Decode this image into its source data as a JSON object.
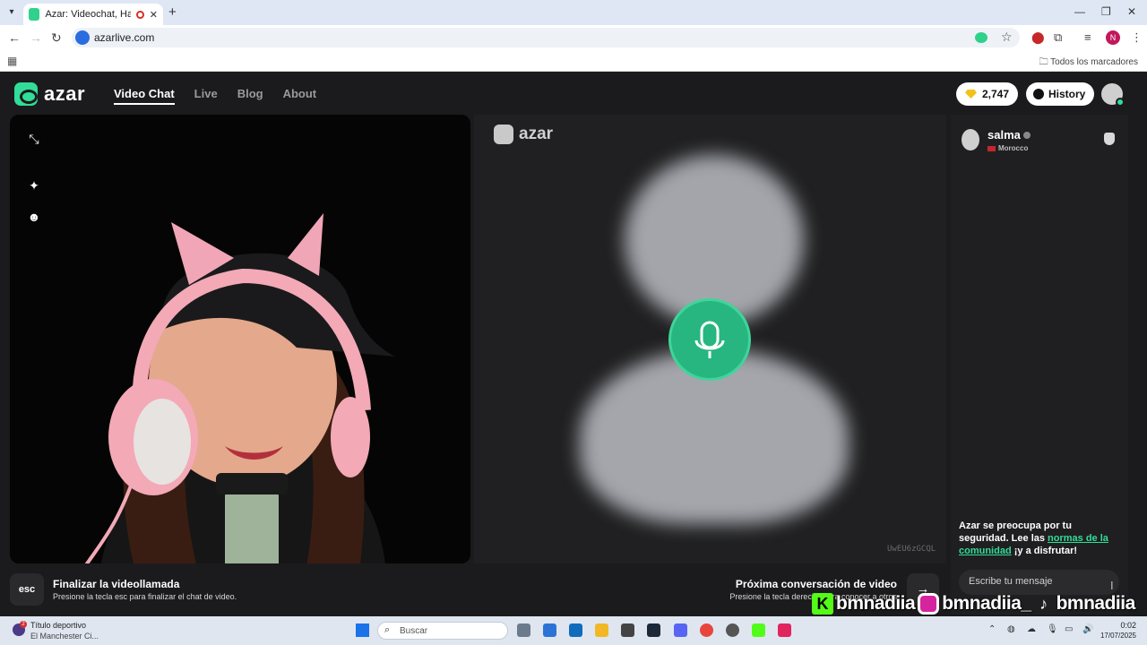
{
  "browser": {
    "tab_title": "Azar: Videochat, Haz nuevos amigos",
    "new_tab": "+",
    "url": "azarlive.com",
    "bookmarks_all": "Todos los marcadores",
    "profile_initial": "N",
    "window_controls": {
      "minimize": "—",
      "restore": "❐",
      "close": "✕"
    }
  },
  "header": {
    "logo_text": "azar",
    "nav": [
      {
        "label": "Video Chat",
        "active": true
      },
      {
        "label": "Live",
        "active": false
      },
      {
        "label": "Blog",
        "active": false
      },
      {
        "label": "About",
        "active": false
      }
    ],
    "gems": "2,747",
    "history": "History"
  },
  "video": {
    "partner_logo": "azar",
    "video_id": "UwEU6zGCQL"
  },
  "chat": {
    "partner_name": "salma",
    "partner_country": "Morocco",
    "safety_part1": "Azar se preocupa por tu seguridad. Lee las ",
    "safety_link": "normas de la comunidad",
    "safety_part2": " ¡y a disfrutar!",
    "input_placeholder": "Escribe tu mensaje"
  },
  "footer": {
    "esc_key": "esc",
    "end_title": "Finalizar la videollamada",
    "end_sub": "Presione la tecla esc para finalizar el chat de video.",
    "next_title": "Próxima conversación de video",
    "next_sub": "Presione la tecla derecha para conocer a otros",
    "next_key": "→"
  },
  "watermark": {
    "kick_letter": "K",
    "handle1": "bmnadiia",
    "handle2": "bmnadiia_",
    "handle3": "bmnadiia"
  },
  "taskbar": {
    "news_badge": "2",
    "news_title": "Título deportivo",
    "news_sub": "El Manchester Ci...",
    "search": "Buscar",
    "time": "0:02",
    "date": "17/07/2025"
  }
}
